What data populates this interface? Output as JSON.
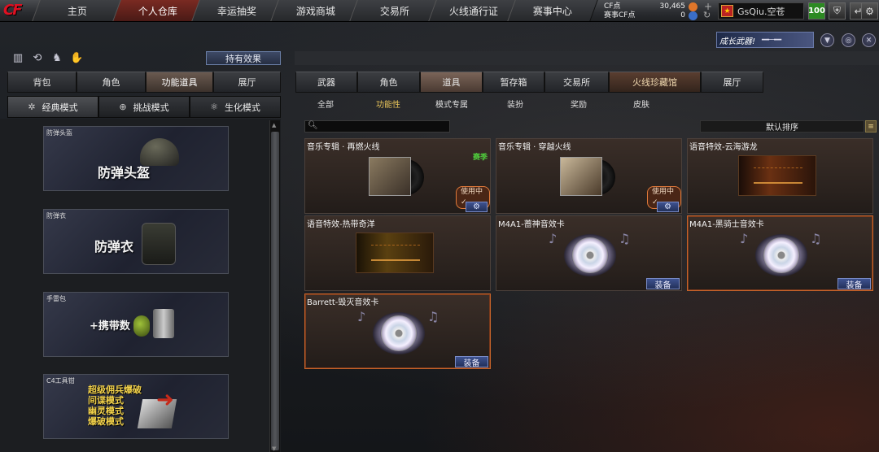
{
  "topnav": {
    "logo": "CF",
    "tabs": [
      "主页",
      "个人仓库",
      "幸运抽奖",
      "游戏商城",
      "交易所",
      "火线通行证",
      "赛事中心"
    ],
    "cf_label": "CF点",
    "cf_value": "30,465",
    "event_cf_label": "赛事CF点",
    "event_cf_value": "0",
    "username": "GsQiu.空苍",
    "level": "100"
  },
  "promo": {
    "text": "成长武器!"
  },
  "left": {
    "hold_effect": "持有效果",
    "tabs": [
      "背包",
      "角色",
      "功能道具",
      "展厅"
    ],
    "modes": [
      "经典模式",
      "挑战模式",
      "生化模式"
    ],
    "cards": [
      {
        "label": "防弹头盔",
        "title": "防弹头盔"
      },
      {
        "label": "防弹衣",
        "title": "防弹衣"
      },
      {
        "label": "手雷包",
        "title": "+携带数"
      },
      {
        "label": "C4工具钳",
        "lines": [
          "超级佣兵爆破",
          "间谍模式",
          "幽灵模式",
          "爆破模式"
        ]
      }
    ]
  },
  "right": {
    "tabs": [
      "武器",
      "角色",
      "道具",
      "暂存箱",
      "交易所",
      "火线珍藏馆",
      "展厅"
    ],
    "subtabs": [
      "全部",
      "功能性",
      "模式专属",
      "装扮",
      "奖励",
      "皮肤"
    ],
    "sort": "默认排序",
    "items": [
      {
        "name": "音乐专辑 · 再燃火线",
        "badge": "赛季",
        "status": "使用中✓"
      },
      {
        "name": "音乐专辑 · 穿越火线",
        "status": "使用中✓"
      },
      {
        "name": "语音特效-云海游龙"
      },
      {
        "name": "语音特效-热带奇洋"
      },
      {
        "name": "M4A1-蔷神音效卡",
        "action": "装备"
      },
      {
        "name": "M4A1-黑骑士音效卡",
        "action": "装备"
      },
      {
        "name": "Barrett-毁灭音效卡",
        "action": "装备"
      }
    ]
  },
  "colors": {
    "accent": "#c8642a",
    "nav_active": "#7a2a22",
    "badge_green": "#4fcb3c",
    "button_blue": "#3e5290"
  }
}
